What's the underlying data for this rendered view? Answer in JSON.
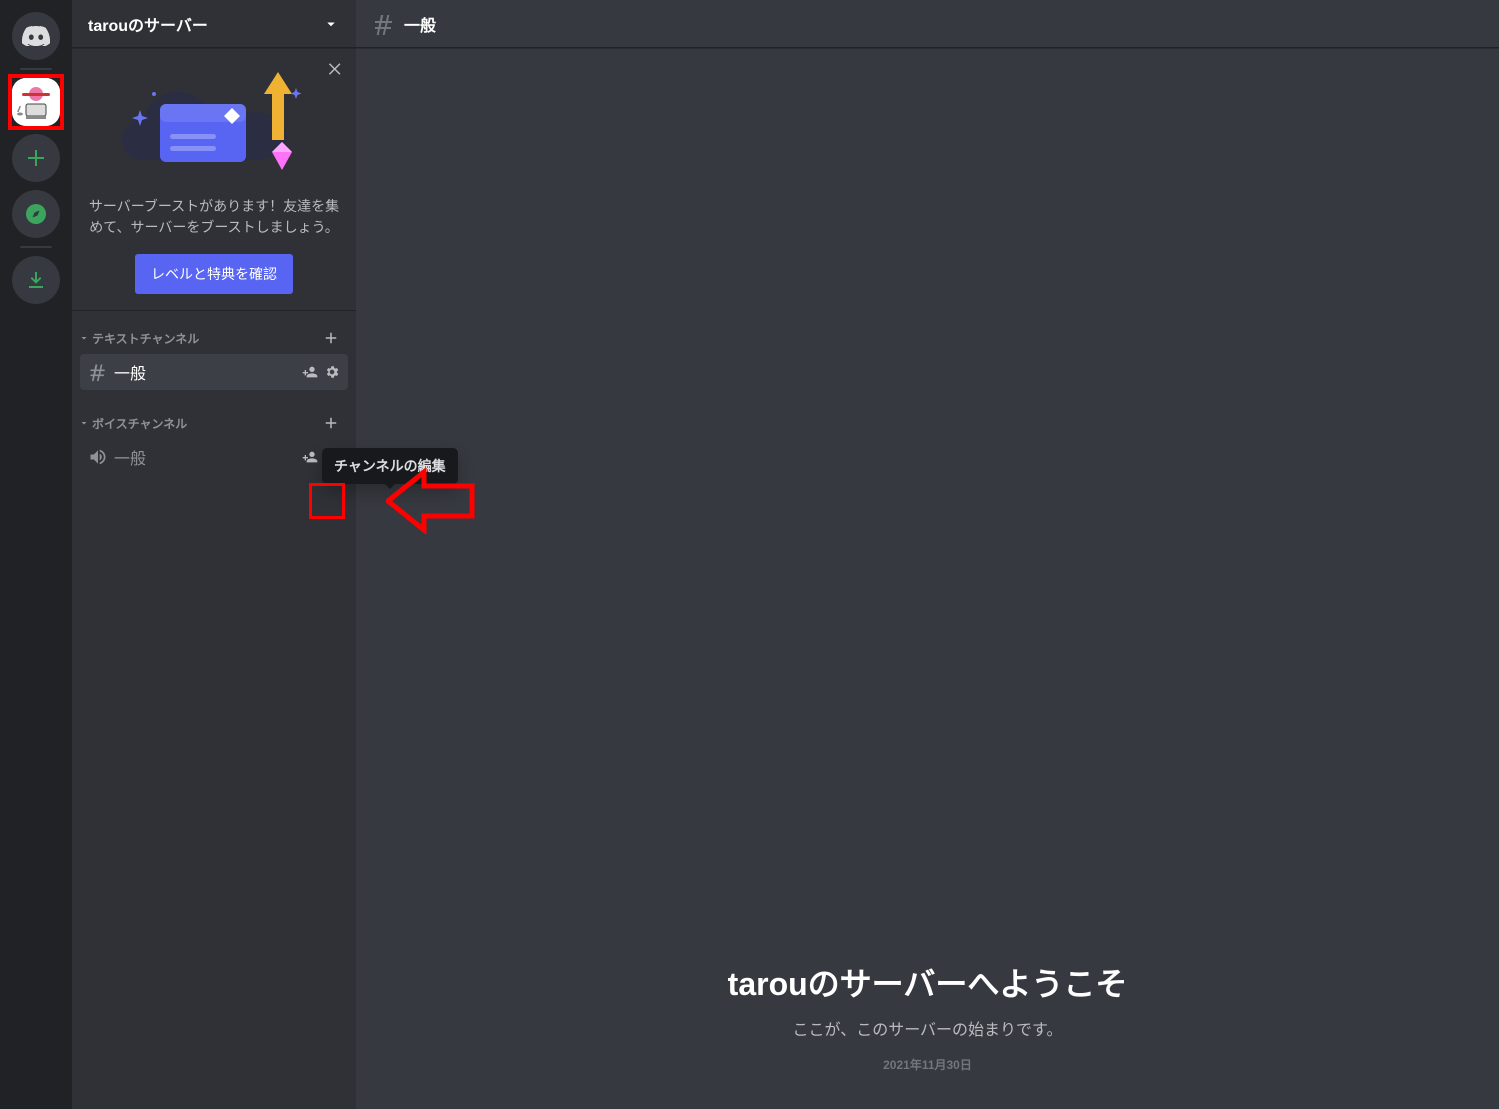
{
  "server_rail": {
    "home_label": "Home",
    "add_label": "Add a Server",
    "explore_label": "Explore",
    "download_label": "Download Apps"
  },
  "server": {
    "name": "tarouのサーバー"
  },
  "boost_banner": {
    "line": "サーバーブーストがあります！友達を集めて、サーバーをブーストしましょう。",
    "button": "レベルと特典を確認"
  },
  "categories": {
    "text_label": "テキストチャンネル",
    "voice_label": "ボイスチャンネル"
  },
  "channels": {
    "text_general": "一般",
    "voice_general": "一般"
  },
  "tooltip": {
    "edit_channel": "チャンネルの編集"
  },
  "header": {
    "channel_name": "一般"
  },
  "welcome": {
    "title": "tarouのサーバーへようこそ",
    "subtitle": "ここが、このサーバーの始まりです。",
    "date": "2021年11月30日"
  }
}
